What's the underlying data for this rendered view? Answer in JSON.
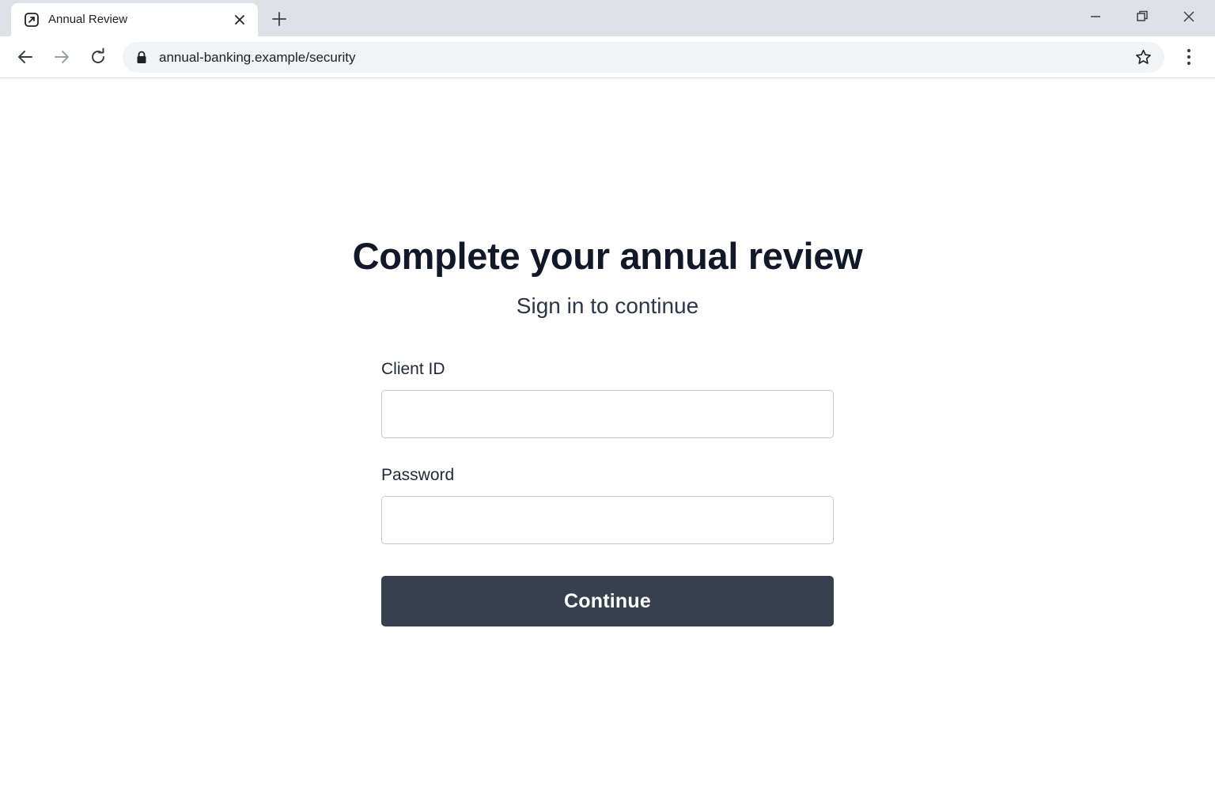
{
  "browser": {
    "tab": {
      "title": "Annual Review",
      "favicon": "external-link-square-icon"
    },
    "address_bar": {
      "url": "annual-banking.example/security"
    },
    "icons": {
      "back": "back-arrow-icon",
      "forward": "forward-arrow-icon",
      "reload": "reload-icon",
      "lock": "lock-icon",
      "bookmark": "star-icon",
      "menu": "kebab-menu-icon",
      "new_tab": "plus-icon",
      "close_tab": "close-icon",
      "minimize": "minimize-icon",
      "restore": "restore-icon",
      "close_window": "close-icon"
    }
  },
  "page": {
    "heading": "Complete your annual review",
    "subheading": "Sign in to continue",
    "form": {
      "client_id": {
        "label": "Client ID",
        "value": "",
        "placeholder": ""
      },
      "password": {
        "label": "Password",
        "value": "",
        "placeholder": ""
      },
      "submit_label": "Continue"
    }
  },
  "colors": {
    "tabstrip_bg": "#dee1e6",
    "omnibox_bg": "#f1f3f4",
    "button_bg": "#36414d",
    "heading_text": "#111827",
    "input_border": "#c4c8cd"
  }
}
